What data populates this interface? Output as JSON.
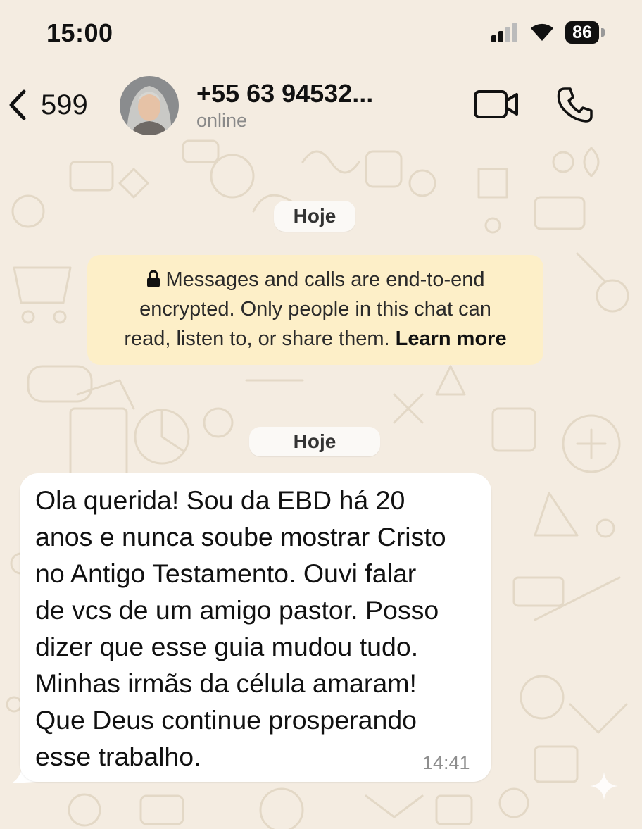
{
  "status_bar": {
    "time": "15:00",
    "battery": "86"
  },
  "header": {
    "back_count": "599",
    "contact_name": "+55 63 94532...",
    "contact_status": "online",
    "icons": [
      "chevron-left-icon",
      "video-camera-icon",
      "phone-icon"
    ]
  },
  "chat": {
    "date_chip_1": "Hoje",
    "encryption_notice": {
      "line1": "Messages and calls are end-to-end",
      "line2": "encrypted. Only people in this chat can",
      "line3": "read, listen to, or share them. ",
      "link": "Learn more"
    },
    "date_chip_2": "Hoje",
    "message": {
      "lines": [
        "Ola querida! Sou da EBD há 20",
        "anos e nunca soube mostrar Cristo",
        "no Antigo Testamento. Ouvi falar",
        "de vcs de um amigo pastor. Posso",
        "dizer que esse guia mudou tudo.",
        "Minhas irmãs da célula amaram!",
        "Que Deus continue prosperando",
        "esse trabalho."
      ],
      "time": "14:41"
    }
  },
  "colors": {
    "background": "#f4ece1",
    "bubble": "#ffffff",
    "notice": "#fdefc8",
    "doodle": "#e4d9c8"
  }
}
